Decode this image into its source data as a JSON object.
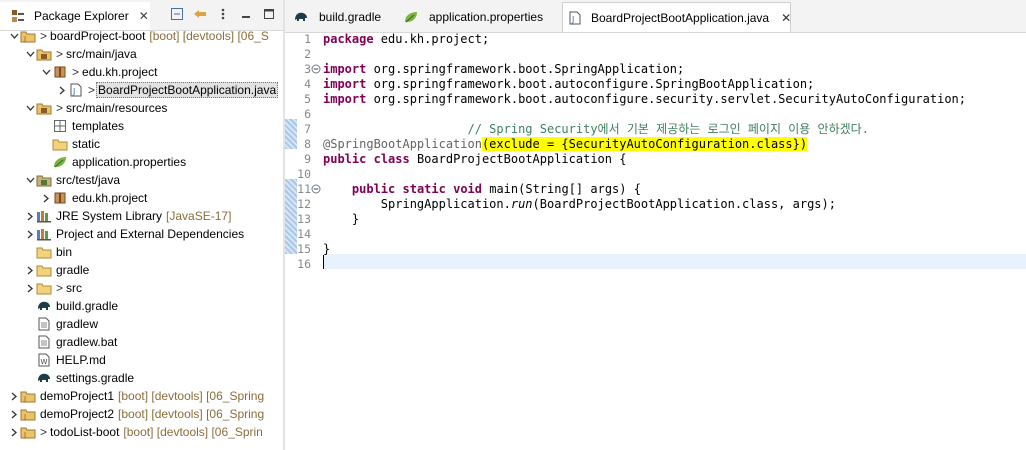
{
  "explorer": {
    "title": "Package Explorer",
    "items": [
      {
        "label": "boardProject-boot",
        "deco": "[boot] [devtools] [06_S",
        "prefix": ">",
        "expanded": true,
        "icon": "project-icon",
        "indent": 0
      },
      {
        "label": "src/main/java",
        "deco": "",
        "prefix": ">",
        "expanded": true,
        "icon": "source-folder-icon",
        "indent": 1
      },
      {
        "label": "edu.kh.project",
        "deco": "",
        "prefix": ">",
        "expanded": true,
        "icon": "package-icon",
        "indent": 2
      },
      {
        "label": "BoardProjectBootApplication.java",
        "deco": "",
        "prefix": ">",
        "expanded": false,
        "icon": "java-file-icon",
        "indent": 3,
        "selected": true
      },
      {
        "label": "src/main/resources",
        "deco": "",
        "prefix": ">",
        "expanded": true,
        "icon": "source-folder-icon",
        "indent": 1
      },
      {
        "label": "templates",
        "deco": "",
        "prefix": "",
        "expanded": null,
        "icon": "package-grid-icon",
        "indent": 2
      },
      {
        "label": "static",
        "deco": "",
        "prefix": "",
        "expanded": null,
        "icon": "folder-icon",
        "indent": 2
      },
      {
        "label": "application.properties",
        "deco": "",
        "prefix": "",
        "expanded": null,
        "icon": "properties-leaf-icon",
        "indent": 2
      },
      {
        "label": "src/test/java",
        "deco": "",
        "prefix": "",
        "expanded": true,
        "icon": "test-source-folder-icon",
        "indent": 1
      },
      {
        "label": "edu.kh.project",
        "deco": "",
        "prefix": "",
        "expanded": false,
        "icon": "package-icon",
        "indent": 2
      },
      {
        "label": "JRE System Library",
        "deco": "[JavaSE-17]",
        "prefix": "",
        "expanded": false,
        "icon": "library-icon",
        "indent": 1
      },
      {
        "label": "Project and External Dependencies",
        "deco": "",
        "prefix": "",
        "expanded": false,
        "icon": "library-icon",
        "indent": 1
      },
      {
        "label": "bin",
        "deco": "",
        "prefix": "",
        "expanded": null,
        "icon": "folder-icon",
        "indent": 1
      },
      {
        "label": "gradle",
        "deco": "",
        "prefix": "",
        "expanded": false,
        "icon": "folder-icon",
        "indent": 1
      },
      {
        "label": "src",
        "deco": "",
        "prefix": ">",
        "expanded": false,
        "icon": "folder-icon",
        "indent": 1
      },
      {
        "label": "build.gradle",
        "deco": "",
        "prefix": "",
        "expanded": null,
        "icon": "gradle-elephant-icon",
        "indent": 1
      },
      {
        "label": "gradlew",
        "deco": "",
        "prefix": "",
        "expanded": null,
        "icon": "text-file-icon",
        "indent": 1
      },
      {
        "label": "gradlew.bat",
        "deco": "",
        "prefix": "",
        "expanded": null,
        "icon": "text-file-icon",
        "indent": 1
      },
      {
        "label": "HELP.md",
        "deco": "",
        "prefix": "",
        "expanded": null,
        "icon": "markdown-file-icon",
        "indent": 1
      },
      {
        "label": "settings.gradle",
        "deco": "",
        "prefix": "",
        "expanded": null,
        "icon": "gradle-elephant-icon",
        "indent": 1
      },
      {
        "label": "demoProject1",
        "deco": "[boot] [devtools] [06_Spring",
        "prefix": "",
        "expanded": false,
        "icon": "project-icon",
        "indent": 0
      },
      {
        "label": "demoProject2",
        "deco": "[boot] [devtools] [06_Spring",
        "prefix": "",
        "expanded": false,
        "icon": "project-icon",
        "indent": 0
      },
      {
        "label": "todoList-boot",
        "deco": "[boot] [devtools] [06_Sprin",
        "prefix": ">",
        "expanded": false,
        "icon": "project-icon",
        "indent": 0
      }
    ]
  },
  "editor": {
    "tabs": [
      {
        "label": "build.gradle",
        "icon": "gradle-elephant-icon",
        "active": false
      },
      {
        "label": "application.properties",
        "icon": "properties-leaf-icon",
        "active": false
      },
      {
        "label": "BoardProjectBootApplication.java",
        "icon": "java-file-icon",
        "active": true
      }
    ],
    "line_numbers": [
      "1",
      "2",
      "3",
      "4",
      "5",
      "6",
      "7",
      "8",
      "9",
      "10",
      "11",
      "12",
      "13",
      "14",
      "15",
      "16"
    ],
    "code": {
      "l1_kw": "package",
      "l1_rest": " edu.kh.project;",
      "l3_kw": "import",
      "l3_rest": " org.springframework.boot.SpringApplication;",
      "l4_kw": "import",
      "l4_rest": " org.springframework.boot.autoconfigure.SpringBootApplication;",
      "l5_kw": "import",
      "l5_rest": " org.springframework.boot.autoconfigure.security.servlet.SecurityAutoConfiguration;",
      "l7_comment": "// Spring Security에서 기본 제공하는 로그인 페이지 이용 안하겠다.",
      "l8_ann": "@SpringBootApplication",
      "l8_hl": "(exclude = {SecurityAutoConfiguration.class})",
      "l9_kw1": "public",
      "l9_kw2": "class",
      "l9_rest": " BoardProjectBootApplication {",
      "l11_kw1": "public",
      "l11_kw2": "static",
      "l11_kw3": "void",
      "l11_rest": " main(String[] args) {",
      "l12_pre": "SpringApplication.",
      "l12_method": "run",
      "l12_rest": "(BoardProjectBootApplication.class, args);",
      "l13": "}",
      "l15": "}"
    }
  }
}
